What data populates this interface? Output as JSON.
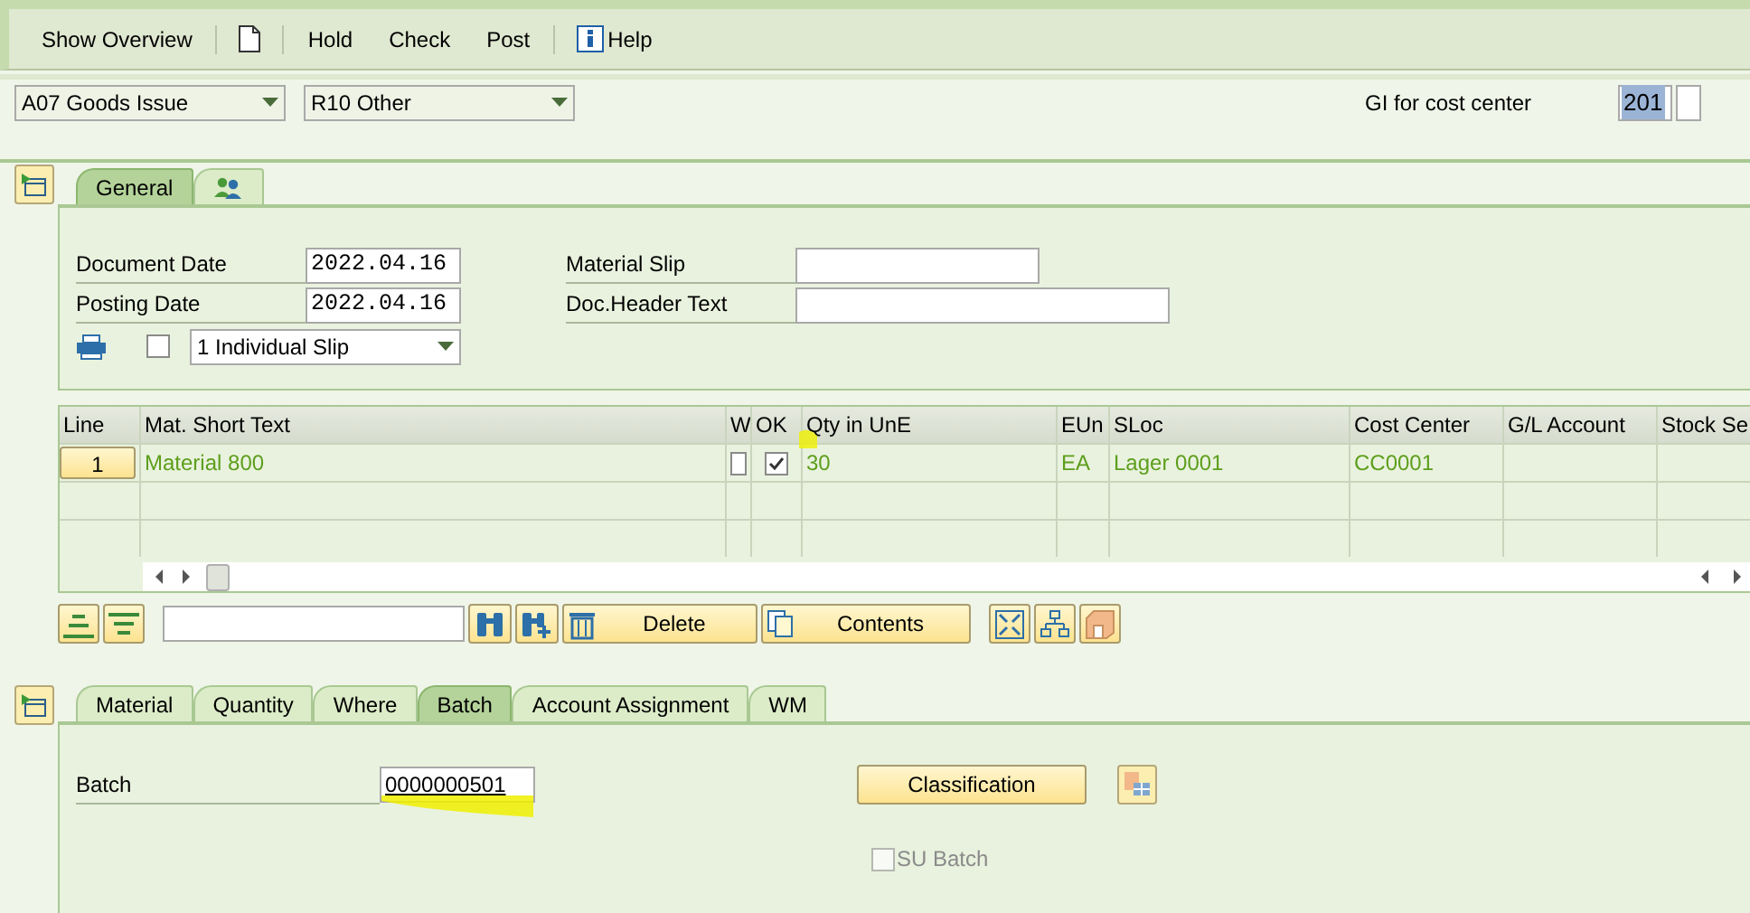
{
  "toolbar": [
    {
      "kind": "text",
      "label": "Show Overview",
      "separator_before": false
    },
    {
      "kind": "document",
      "separator_before": true
    },
    {
      "kind": "text",
      "label": "Hold",
      "separator_before": true
    },
    {
      "kind": "text",
      "label": "Check",
      "separator_before": false
    },
    {
      "kind": "text",
      "label": "Post",
      "separator_before": false
    },
    {
      "kind": "info",
      "label": "Help",
      "separator_before": true
    }
  ],
  "transaction": {
    "action": "A07 Goods Issue",
    "reference": "R10 Other",
    "movement_label": "GI for cost center",
    "movement_type": "201"
  },
  "header_tabs": [
    {
      "kind": "text",
      "label": "General",
      "selected": true
    },
    {
      "kind": "people",
      "selected": false
    }
  ],
  "general": {
    "dates": [
      {
        "label": "Document Date",
        "value": "2022.04.16"
      },
      {
        "label": "Posting Date",
        "value": "2022.04.16"
      }
    ],
    "texts": [
      {
        "label": "Material Slip"
      },
      {
        "label": "Doc.Header Text"
      }
    ],
    "print_checked": false,
    "print_version": "1 Individual Slip"
  },
  "table": {
    "columns": [
      "Line",
      "Mat. Short Text",
      "W",
      "OK",
      "Qty in UnE",
      "EUn",
      "SLoc",
      "Cost Center",
      "G/L Account",
      "Stock Se"
    ],
    "rows": [
      {
        "line": "1",
        "text": "Material 800",
        "w_checked": false,
        "ok_checked": true,
        "qty": "30",
        "unit": "EA",
        "sloc": "Lager 0001",
        "cost_center": "CC0001"
      }
    ]
  },
  "table_actions": {
    "delete": "Delete",
    "contents": "Contents"
  },
  "detail_tabs": [
    {
      "label": "Material",
      "selected": false
    },
    {
      "label": "Quantity",
      "selected": false
    },
    {
      "label": "Where",
      "selected": false
    },
    {
      "label": "Batch",
      "selected": true
    },
    {
      "label": "Account Assignment",
      "selected": false
    },
    {
      "label": "WM",
      "selected": false
    }
  ],
  "batch": {
    "label": "Batch",
    "value": "0000000501",
    "classification": "Classification",
    "su_batch_label": "SU Batch",
    "su_batch_checked": false,
    "su_batch_disabled": true
  }
}
